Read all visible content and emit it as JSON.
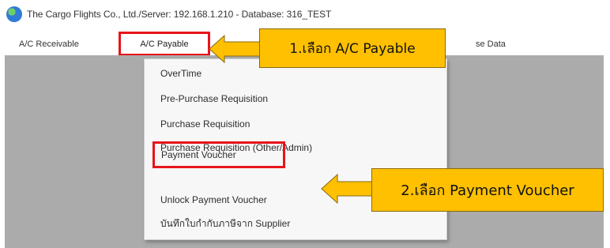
{
  "window": {
    "title": "The Cargo Flights Co., Ltd./Server: 192.168.1.210 - Database: 316_TEST",
    "icon": "globe-icon"
  },
  "menu": {
    "ac_receivable": "A/C Receivable",
    "ac_payable": "A/C Payable",
    "base_data": "se Data"
  },
  "dropdown": {
    "items": [
      "OverTime",
      "Pre-Purchase Requisition",
      "Purchase Requisition",
      "Purchase Requisition (Other/Admin)",
      "Payment Voucher",
      "Unlock Payment Voucher",
      "บันทึกใบกำกับภาษีจาก Supplier"
    ]
  },
  "callouts": {
    "step1": "1.เลือก A/C Payable",
    "step2": "2.เลือก Payment Voucher"
  },
  "colors": {
    "highlight_border": "#e8141b",
    "callout_fill": "#fec000",
    "app_background": "#ababab"
  }
}
